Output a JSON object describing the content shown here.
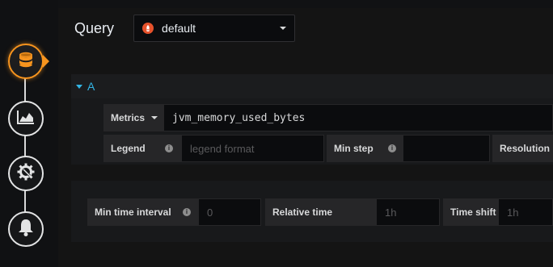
{
  "rail": {
    "items": [
      {
        "name": "database-icon",
        "active": true
      },
      {
        "name": "chart-area-icon",
        "active": false
      },
      {
        "name": "cog-wrench-icon",
        "active": false
      },
      {
        "name": "bell-icon",
        "active": false
      }
    ],
    "accent": "#f7941e"
  },
  "query": {
    "title": "Query",
    "datasource": "default",
    "datasource_icon": "prometheus-icon",
    "datasource_color": "#e6522c"
  },
  "target": {
    "ref_id": "A",
    "ref_color": "#33b5e5",
    "metrics_label": "Metrics",
    "expr": "jvm_memory_used_bytes",
    "legend_label": "Legend",
    "legend_placeholder": "legend format",
    "min_step_label": "Min step",
    "min_step_value": "",
    "resolution_label": "Resolution"
  },
  "options": {
    "min_interval_label": "Min time interval",
    "min_interval_placeholder": "0",
    "relative_time_label": "Relative time",
    "relative_time_placeholder": "1h",
    "time_shift_label": "Time shift",
    "time_shift_placeholder": "1h"
  }
}
